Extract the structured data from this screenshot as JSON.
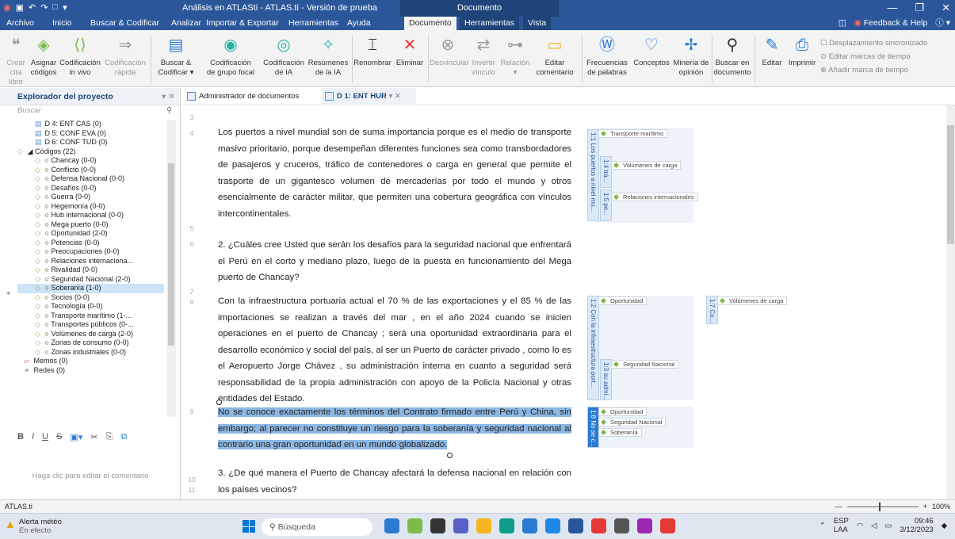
{
  "titlebar": {
    "app_title": "Análisis en ATLASti - ATLAS.ti - Versión de prueba",
    "context_tab_group": "Documento",
    "quick_access": [
      "atlas-logo-icon",
      "save-icon",
      "undo-icon",
      "redo-icon",
      "new-icon",
      "dropdown-icon"
    ],
    "window_controls": [
      "—",
      "❐",
      "✕"
    ]
  },
  "menu_tabs": [
    "Archivo",
    "Inicio",
    "Buscar & Codificar",
    "Analizar",
    "Importar & Exportar",
    "Herramientas",
    "Ayuda",
    "Documento",
    "Herramientas",
    "Vista"
  ],
  "active_tab": "Documento",
  "right_menu": {
    "feedback": "Feedback & Help"
  },
  "ribbon": {
    "buttons": [
      {
        "label1": "Crear cita",
        "label2": "libre",
        "icon": "quote-icon",
        "disabled": true
      },
      {
        "label1": "Asignar",
        "label2": "códigos",
        "icon": "assign-code-icon",
        "disabled": false
      },
      {
        "label1": "Codificación",
        "label2": "in vivo",
        "icon": "in-vivo-icon",
        "disabled": false
      },
      {
        "label1": "Codificación",
        "label2": "rápida",
        "icon": "quick-code-icon",
        "disabled": true
      },
      {
        "label1": "Buscar &",
        "label2": "Codificar ▾",
        "icon": "search-code-icon",
        "disabled": false
      },
      {
        "label1": "Codificación",
        "label2": "de grupo focal",
        "icon": "focus-group-icon",
        "disabled": false
      },
      {
        "label1": "Codificación",
        "label2": "de IA",
        "icon": "ai-code-icon",
        "disabled": false
      },
      {
        "label1": "Resúmenes",
        "label2": "de la IA",
        "icon": "ai-summary-icon",
        "disabled": false
      },
      {
        "label1": "Renombrar",
        "label2": "",
        "icon": "rename-icon",
        "disabled": false
      },
      {
        "label1": "Eliminar",
        "label2": "",
        "icon": "delete-icon",
        "disabled": false
      },
      {
        "label1": "Desvincular",
        "label2": "",
        "icon": "unlink-icon",
        "disabled": true
      },
      {
        "label1": "Invertir",
        "label2": "vínculo",
        "icon": "invert-link-icon",
        "disabled": true
      },
      {
        "label1": "Relación",
        "label2": "▾",
        "icon": "relation-icon",
        "disabled": true
      },
      {
        "label1": "Editar",
        "label2": "comentario",
        "icon": "comment-icon",
        "disabled": false
      },
      {
        "label1": "Frecuencias",
        "label2": "de palabras",
        "icon": "word-freq-icon",
        "disabled": false
      },
      {
        "label1": "Conceptos",
        "label2": "",
        "icon": "concepts-icon",
        "disabled": false
      },
      {
        "label1": "Minería de",
        "label2": "opinión",
        "icon": "opinion-icon",
        "disabled": false
      },
      {
        "label1": "Buscar en",
        "label2": "documento",
        "icon": "doc-search-icon",
        "disabled": false
      },
      {
        "label1": "Editar",
        "label2": "",
        "icon": "edit-icon",
        "disabled": false
      },
      {
        "label1": "Imprimir",
        "label2": "",
        "icon": "print-icon",
        "disabled": false
      }
    ],
    "side_options": [
      "Desplazamiento sincronizado",
      "Editar marcas de tiempo",
      "Añadir marca de tiempo"
    ]
  },
  "explorer": {
    "title": "Explorador del proyecto",
    "search_placeholder": "Buscar",
    "items": [
      {
        "label": "D 4: ENT CAS (0)",
        "type": "doc"
      },
      {
        "label": "D 5: CONF EVA (0)",
        "type": "doc"
      },
      {
        "label": "D 6: CONF TUD (0)",
        "type": "doc"
      },
      {
        "label": "◢ Códigos (22)",
        "type": "group"
      },
      {
        "label": "Chancay (0-0)",
        "type": "code"
      },
      {
        "label": "Conflicto (0-0)",
        "type": "code"
      },
      {
        "label": "Defensa Nacional (0-0)",
        "type": "code"
      },
      {
        "label": "Desafíos (0-0)",
        "type": "code"
      },
      {
        "label": "Guerra (0-0)",
        "type": "code"
      },
      {
        "label": "Hegemonía (0-0)",
        "type": "code"
      },
      {
        "label": "Hub internacional (0-0)",
        "type": "code"
      },
      {
        "label": "Mega puerto (0-0)",
        "type": "code"
      },
      {
        "label": "Oportunidad (2-0)",
        "type": "code"
      },
      {
        "label": "Potencias (0-0)",
        "type": "code"
      },
      {
        "label": "Preocupaciones (0-0)",
        "type": "code"
      },
      {
        "label": "Relaciones internaciona...",
        "type": "code"
      },
      {
        "label": "Rivalidad (0-0)",
        "type": "code"
      },
      {
        "label": "Seguridad Nacional (2-0)",
        "type": "code"
      },
      {
        "label": "Soberanía (1-0)",
        "type": "code",
        "selected": true
      },
      {
        "label": "Socios (0-0)",
        "type": "code"
      },
      {
        "label": "Tecnología (0-0)",
        "type": "code"
      },
      {
        "label": "Transporte marítimo (1-...",
        "type": "code"
      },
      {
        "label": "Transportes públicos (0-...",
        "type": "code"
      },
      {
        "label": "Volúmenes de carga (2-0)",
        "type": "code"
      },
      {
        "label": "Zonas de consumo (0-0)",
        "type": "code"
      },
      {
        "label": "Zonas industriales (0-0)",
        "type": "code"
      },
      {
        "label": "Memos (0)",
        "type": "memo"
      },
      {
        "label": "Redes (0)",
        "type": "net"
      }
    ],
    "comment_placeholder": "Haga clic para editar el comentario"
  },
  "doc_tabs": [
    {
      "label": "Administrador de documentos",
      "active": false
    },
    {
      "label": "D 1: ENT HUR",
      "active": true
    }
  ],
  "document": {
    "line_numbers": [
      "3",
      "4",
      "5",
      "6",
      "7",
      "8",
      "9",
      "10",
      "11"
    ],
    "p1": "Los puertos a nivel mundial son de suma importancia porque es el medio de transporte masivo prioritario, porque desempeñan diferentes funciones sea como transbordadores de pasajeros y cruceros, tráfico de contenedores o carga en general que permite el trasporte de un gigantesco volumen de mercaderías por todo el mundo y otros esencialmente de carácter militar, que permiten una cobertura geográfica con vínculos intercontinentales.",
    "p2": "2. ¿Cuáles cree Usted que serán los desafíos para la seguridad nacional que enfrentará el Perú en el corto y mediano plazo, luego de la puesta en funcionamiento del Mega puerto de Chancay?",
    "p3": "Con la infraestructura portuaria actual el 70 % de las exportaciones y el 85 % de las importaciones se realizan a través del mar , en el año 2024 cuando se inicien operaciones en el puerto de Chancay ; será una oportunidad extraordinaria para el desarrollo económico y social del país, al ser un Puerto de carácter privado , como lo es el Aeropuerto Jorge Chávez , su administración interna en cuanto a seguridad será responsabilidad de la propia administración con apoyo de la Policía Nacional y otras entidades del Estado.",
    "p4": "No se conoce exactamente los términos del Contrato firmado entre Perú y China, sin embargo; al parecer no constituye un riesgo para la soberanía y seguridad nacional al contrario una gran oportunidad en un mundo globalizado.",
    "p5": "3. ¿De qué manera el Puerto de Chancay afectará la defensa nacional en relación con los países vecinos?"
  },
  "margin": {
    "bars": [
      "1:1 Los puertos a nivel mu...",
      "1:4 trá...",
      "1:5 pe...",
      "1:2 Con la infraestructura port...",
      "1:3 su admi...",
      "1:7 Co...",
      "1:8 No se c..."
    ],
    "tags": [
      "Transporte marítimo",
      "Volúmenes de carga",
      "Relaciones internacionales",
      "Oportunidad",
      "Volúmenes de carga",
      "Seguridad Nacional",
      "Oportunidad",
      "Seguridad Nacional",
      "Soberanía"
    ]
  },
  "statusbar": {
    "app": "ATLAS.ti",
    "zoom": "100%"
  },
  "taskbar": {
    "alert_title": "Alerta météo",
    "alert_sub": "En efecto",
    "search": "Búsqueda",
    "lang1": "ESP",
    "lang2": "LAA",
    "time": "09:46",
    "date": "3/12/2023"
  }
}
